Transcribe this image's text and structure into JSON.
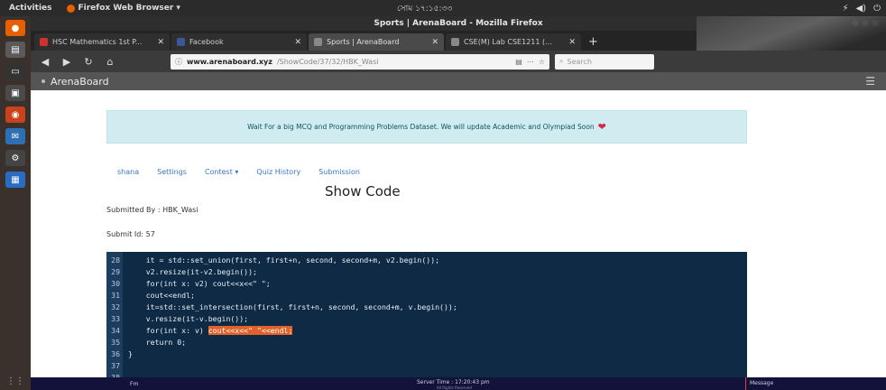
{
  "system": {
    "activities": "Activities",
    "app_menu": "Firefox Web Browser ▾",
    "clock": "সোম ১৭:১৫:৩৩",
    "tray": [
      "⚡",
      "◀)",
      "⏻"
    ]
  },
  "browser": {
    "window_title": "Sports | ArenaBoard - Mozilla Firefox",
    "tabs": [
      {
        "label": "HSC Mathematics 1st P...",
        "color": "#d0312d",
        "active": false
      },
      {
        "label": "Facebook",
        "color": "#3b5998",
        "active": false
      },
      {
        "label": "Sports | ArenaBoard",
        "color": "#888888",
        "active": true
      },
      {
        "label": "CSE(M) Lab CSE1211 (...",
        "color": "#888888",
        "active": false
      }
    ],
    "url_host": "www.arenaboard.xyz",
    "url_path": "/ShowCode/37/32/HBK_Wasi",
    "url_prefix": "www.",
    "search_placeholder": "Search"
  },
  "site": {
    "brand": "ArenaBoard",
    "banner_text": "Wait For a big MCQ and Programming Problems Dataset. We will update Academic and Olympiad Soon",
    "menu": [
      "shana",
      "Settings",
      "Contest ▾",
      "Quiz History",
      "Submission"
    ],
    "page_title": "Show Code",
    "submitted_by": "Submitted By : HBK_Wasi",
    "submit_id": "Submit Id: 57",
    "code_lines": [
      {
        "n": "28",
        "text": "    it = std::set_union(first, first+n, second, second+m, v2.begin());"
      },
      {
        "n": "29",
        "text": "    v2.resize(it-v2.begin());"
      },
      {
        "n": "30",
        "text": "    for(int x: v2) cout<<x<<\" \";"
      },
      {
        "n": "31",
        "text": "    cout<<endl;"
      },
      {
        "n": "32",
        "text": "    it=std::set_intersection(first, first+n, second, second+m, v.begin());"
      },
      {
        "n": "33",
        "text": "    v.resize(it-v.begin());"
      },
      {
        "n": "34",
        "text": "    for(int x: v) ",
        "highlight": "cout<<x<<\" \"<<endl;"
      },
      {
        "n": "35",
        "text": "    return 0;"
      },
      {
        "n": "36",
        "text": "}"
      },
      {
        "n": "37",
        "text": ""
      },
      {
        "n": "38",
        "text": ""
      }
    ],
    "footer_left": "Fm",
    "footer_mid": "Server Time : 17:20:43 pm",
    "footer_sub": "All Rights Reserved",
    "footer_right": "Message"
  }
}
